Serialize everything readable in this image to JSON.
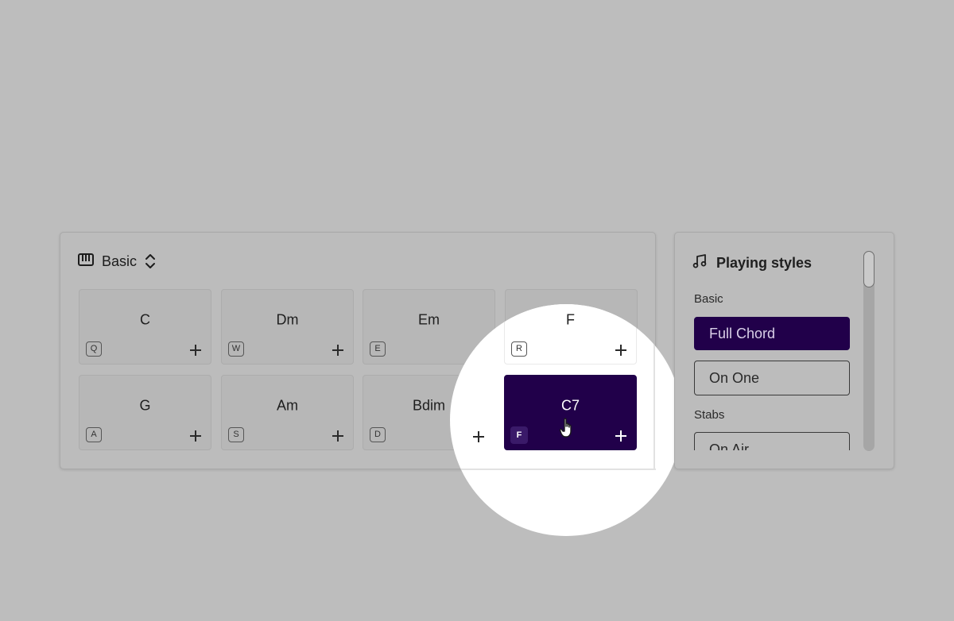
{
  "chord_panel": {
    "set_name": "Basic",
    "icons": {
      "set_icon": "piano-keys-icon",
      "switch_icon": "chevron-up-down-icon"
    },
    "pads": [
      {
        "chord": "C",
        "key": "Q"
      },
      {
        "chord": "Dm",
        "key": "W"
      },
      {
        "chord": "Em",
        "key": "E"
      },
      {
        "chord": "F",
        "key": "R"
      },
      {
        "chord": "G",
        "key": "A"
      },
      {
        "chord": "Am",
        "key": "S"
      },
      {
        "chord": "Bdim",
        "key": "D"
      },
      {
        "chord": "C7",
        "key": "F"
      }
    ],
    "active_pad": "C7",
    "add_icon": "plus-icon"
  },
  "playing_styles": {
    "title": "Playing styles",
    "icon": "music-note-icon",
    "sections": [
      {
        "label": "Basic",
        "options": [
          "Full Chord",
          "On One"
        ]
      },
      {
        "label": "Stabs",
        "options": [
          "On Air"
        ]
      }
    ],
    "selected": "Full Chord"
  },
  "colors": {
    "accent": "#21004a",
    "background": "#bdbdbd",
    "spotlight": "#ffffff"
  }
}
